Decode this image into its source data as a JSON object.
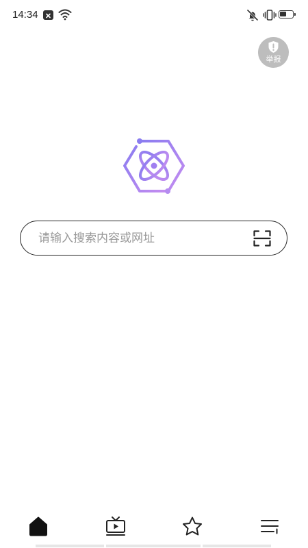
{
  "status_bar": {
    "time": "14:34",
    "notification_icon": "x-notification-icon",
    "wifi_icon": "wifi-icon",
    "mute_icon": "vibrate-off-icon",
    "vibrate_icon": "vibrate-icon",
    "battery_icon": "battery-icon",
    "battery_level": 0.55
  },
  "report": {
    "label": "举报",
    "icon": "shield-exclamation-icon"
  },
  "logo": {
    "icon": "hexagon-atom-logo",
    "colors": {
      "start": "#8a7cf0",
      "end": "#c58df0"
    }
  },
  "search": {
    "placeholder": "请输入搜索内容或网址",
    "value": "",
    "scan_icon": "scan-icon"
  },
  "bottom_nav": {
    "items": [
      {
        "id": "home",
        "icon": "home-icon",
        "active": true
      },
      {
        "id": "video",
        "icon": "tv-play-icon",
        "active": false
      },
      {
        "id": "favorites",
        "icon": "star-icon",
        "active": false
      },
      {
        "id": "menu",
        "icon": "menu-icon",
        "active": false
      }
    ]
  },
  "colors": {
    "background": "#ffffff",
    "text": "#222222",
    "placeholder": "#999999",
    "report_bg": "#bdbdbd"
  }
}
